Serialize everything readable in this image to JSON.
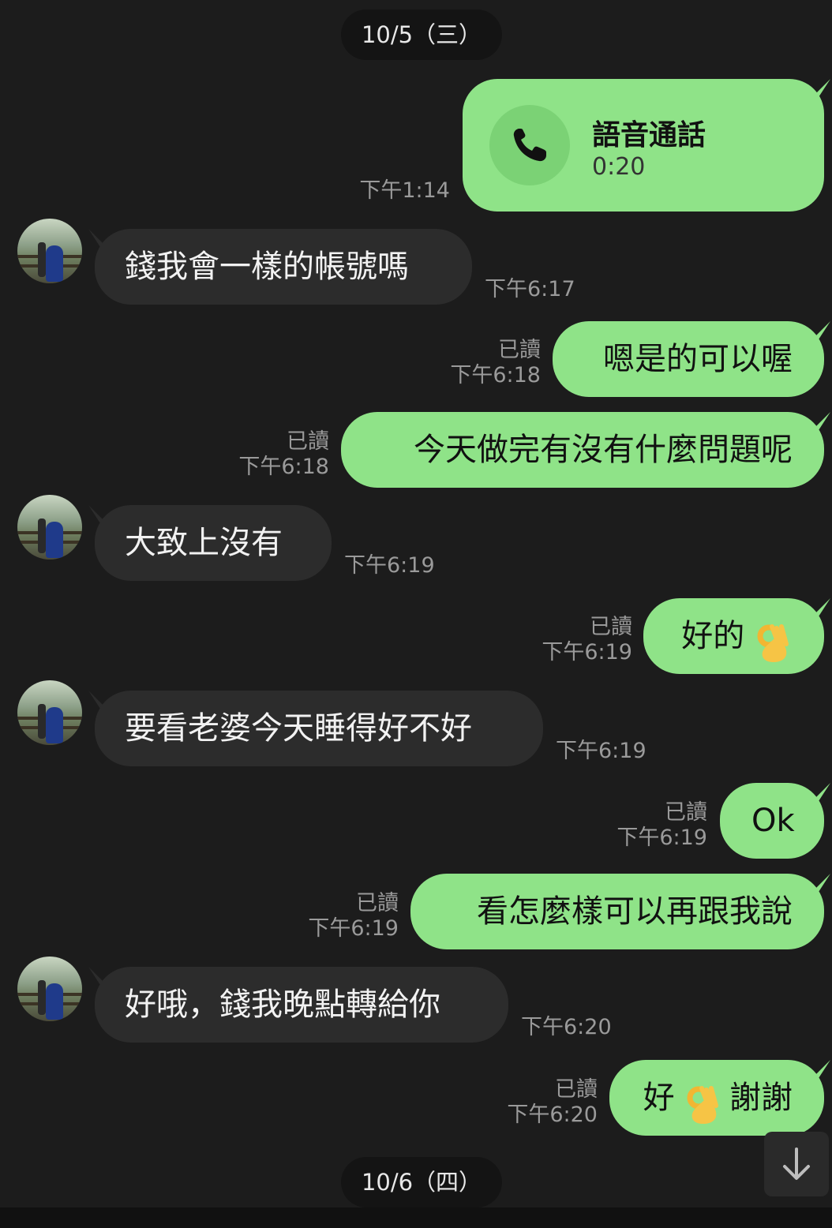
{
  "dates": {
    "top": "10/5（三）",
    "bottom": "10/6（四）"
  },
  "call": {
    "title": "語音通話",
    "duration": "0:20",
    "time": "下午1:14"
  },
  "read_label": "已讀",
  "messages": [
    {
      "text": "錢我會一樣的帳號嗎",
      "time": "下午6:17"
    },
    {
      "text": "嗯是的可以喔",
      "time": "下午6:18"
    },
    {
      "text": "今天做完有沒有什麼問題呢",
      "time": "下午6:18"
    },
    {
      "text": "大致上沒有",
      "time": "下午6:19"
    },
    {
      "text": "好的",
      "time": "下午6:19"
    },
    {
      "text": "要看老婆今天睡得好不好",
      "time": "下午6:19"
    },
    {
      "text": "Ok",
      "time": "下午6:19"
    },
    {
      "text": "看怎麼樣可以再跟我說",
      "time": "下午6:19"
    },
    {
      "text": "好哦，錢我晚點轉給你",
      "time": "下午6:20"
    },
    {
      "text_before": "好",
      "text_after": "謝謝",
      "time": "下午6:20"
    }
  ],
  "icons": {
    "call": "phone-icon",
    "reaction": "ok-hand-emoji",
    "scroll": "arrow-down-icon"
  }
}
